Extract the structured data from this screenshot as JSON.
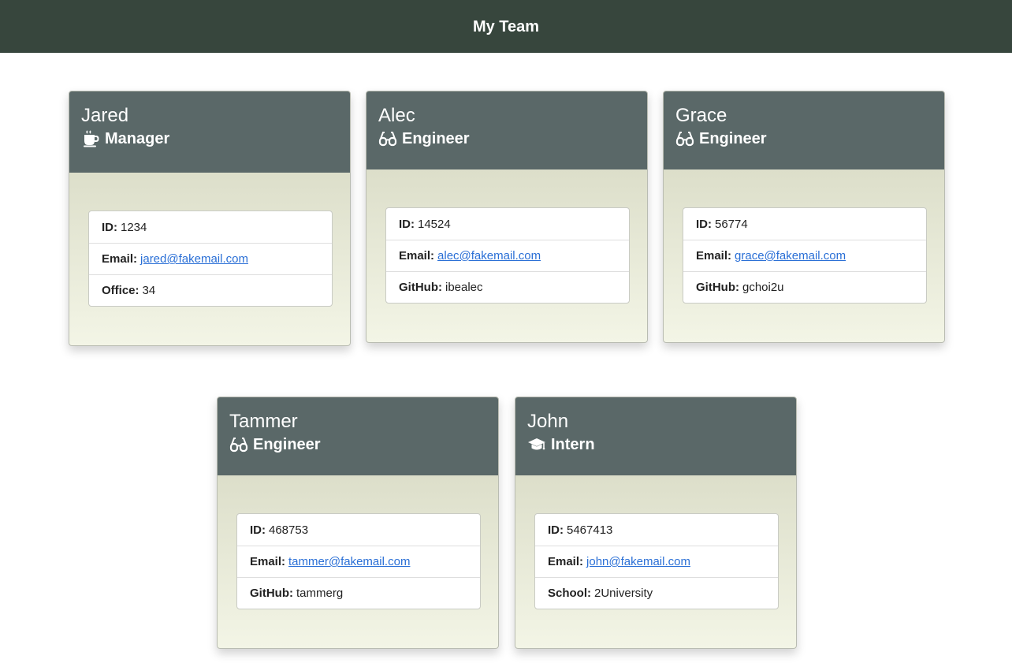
{
  "header": {
    "title": "My Team"
  },
  "cards": [
    {
      "name": "Jared",
      "role": "Manager",
      "icon": "coffee-icon",
      "fields": [
        {
          "label": "ID:",
          "value": "1234"
        },
        {
          "label": "Email:",
          "value": "jared@fakemail.com",
          "link": true
        },
        {
          "label": "Office:",
          "value": "34"
        }
      ]
    },
    {
      "name": "Alec",
      "role": "Engineer",
      "icon": "glasses-icon",
      "fields": [
        {
          "label": "ID:",
          "value": "14524"
        },
        {
          "label": "Email:",
          "value": "alec@fakemail.com",
          "link": true
        },
        {
          "label": "GitHub:",
          "value": "ibealec"
        }
      ]
    },
    {
      "name": "Grace",
      "role": "Engineer",
      "icon": "glasses-icon",
      "fields": [
        {
          "label": "ID:",
          "value": "56774"
        },
        {
          "label": "Email:",
          "value": "grace@fakemail.com",
          "link": true
        },
        {
          "label": "GitHub:",
          "value": "gchoi2u"
        }
      ]
    },
    {
      "name": "Tammer",
      "role": "Engineer",
      "icon": "glasses-icon",
      "fields": [
        {
          "label": "ID:",
          "value": "468753"
        },
        {
          "label": "Email:",
          "value": "tammer@fakemail.com",
          "link": true
        },
        {
          "label": "GitHub:",
          "value": "tammerg"
        }
      ]
    },
    {
      "name": "John",
      "role": "Intern",
      "icon": "graduation-cap-icon",
      "fields": [
        {
          "label": "ID:",
          "value": "5467413"
        },
        {
          "label": "Email:",
          "value": "john@fakemail.com",
          "link": true
        },
        {
          "label": "School:",
          "value": "2University"
        }
      ]
    }
  ]
}
